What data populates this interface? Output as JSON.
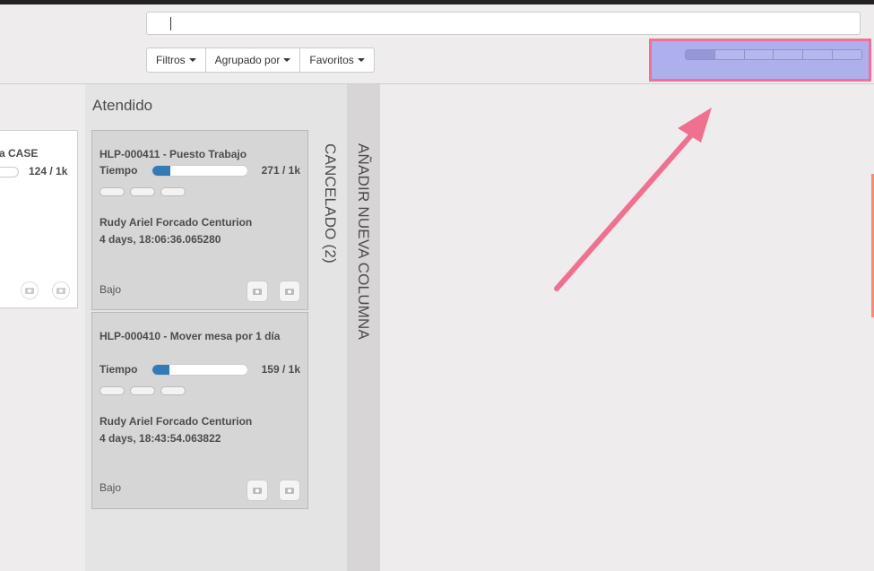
{
  "search": {
    "value": "",
    "placeholder": ""
  },
  "filters": {
    "filtros": "Filtros",
    "agrupado": "Agrupado por",
    "favoritos": "Favoritos"
  },
  "view_switcher": {
    "segments": 6,
    "active_index": 0
  },
  "colors": {
    "highlight_border": "#f07098",
    "highlight_fill": "#aeb0ee",
    "arrow": "#f0708f",
    "progress": "#337ab7"
  },
  "columns": {
    "left": {
      "card": {
        "title": "a CASE",
        "progress_label": "124 / 1k"
      }
    },
    "atendido": {
      "title": "Atendido",
      "cards": [
        {
          "title": "HLP-000411 - Puesto Trabajo",
          "time_label": "Tiempo",
          "progress_value": 271,
          "progress_max": 1000,
          "progress_label": "271 / 1k",
          "user": "Rudy Ariel Forcado Centurion",
          "duration": "4 days, 18:06:36.065280",
          "priority": "Bajo"
        },
        {
          "title": "HLP-000410 - Mover mesa por 1 día",
          "time_label": "Tiempo",
          "progress_value": 159,
          "progress_max": 1000,
          "progress_label": "159 / 1k",
          "user": "Rudy Ariel Forcado Centurion",
          "duration": "4 days, 18:43:54.063822",
          "priority": "Bajo"
        }
      ]
    },
    "cancelado": {
      "title": "CANCELADO (2)"
    },
    "add": {
      "label": "AÑADIR NUEVA COLUMNA"
    }
  }
}
